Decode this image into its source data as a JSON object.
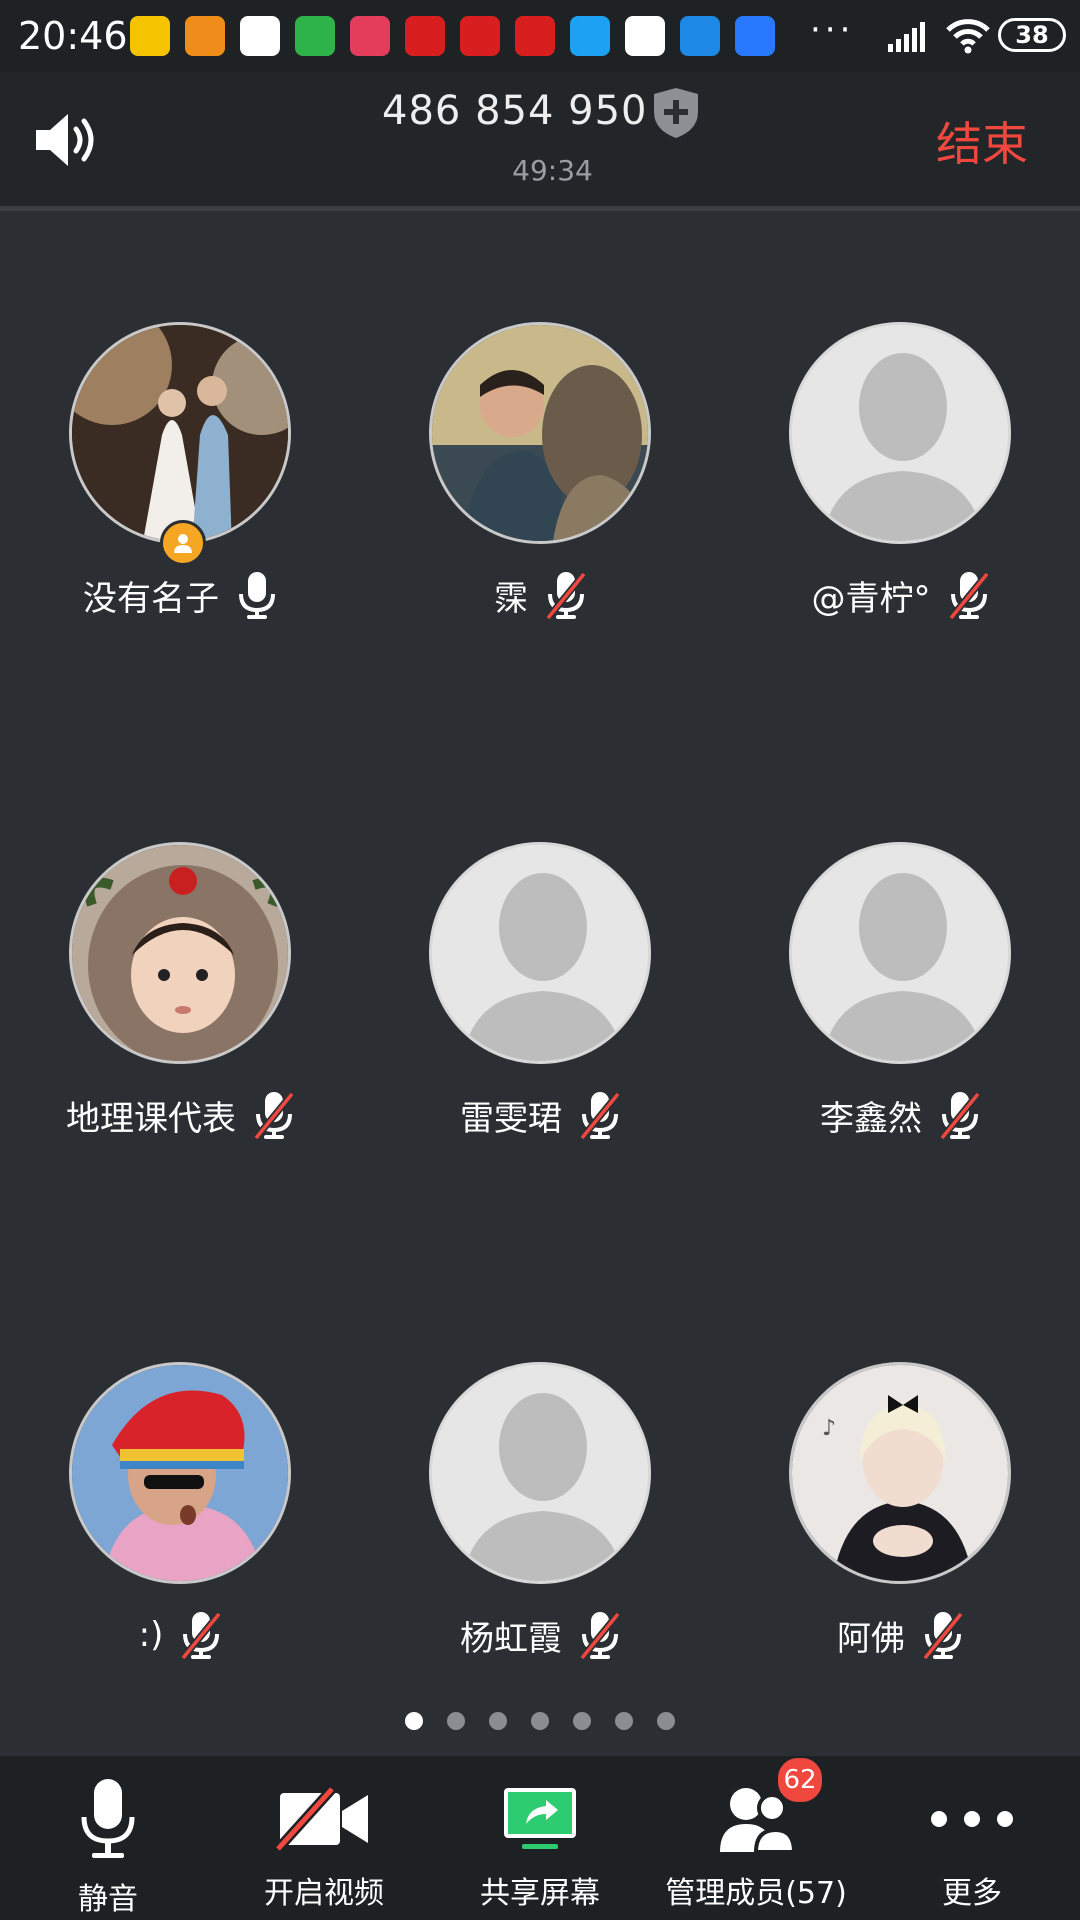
{
  "status_bar": {
    "time": "20:46",
    "battery": "38",
    "app_icons": [
      {
        "name": "app-icon-1",
        "color": "#f5c400"
      },
      {
        "name": "app-icon-fang",
        "color": "#f08c1a"
      },
      {
        "name": "app-icon-mi",
        "color": "#ffffff"
      },
      {
        "name": "app-icon-play",
        "color": "#2db34a"
      },
      {
        "name": "app-icon-cartoon",
        "color": "#e43d5b"
      },
      {
        "name": "app-icon-red-1",
        "color": "#d81e1e"
      },
      {
        "name": "app-icon-red-2",
        "color": "#d81e1e"
      },
      {
        "name": "app-icon-red-3",
        "color": "#d81e1e"
      },
      {
        "name": "app-icon-blue",
        "color": "#1da1f2"
      },
      {
        "name": "app-icon-youku",
        "color": "#ffffff"
      },
      {
        "name": "app-icon-n",
        "color": "#1e88e5"
      },
      {
        "name": "app-icon-map",
        "color": "#2979ff"
      }
    ],
    "overflow": "···"
  },
  "header": {
    "meeting_id": "486 854 950",
    "duration": "49:34",
    "end_label": "结束"
  },
  "participants": [
    {
      "name": "没有名子",
      "muted": false,
      "avatar": "photo-wedding",
      "host": true
    },
    {
      "name": "霂",
      "muted": true,
      "avatar": "photo-boys"
    },
    {
      "name": "@青柠°",
      "muted": true,
      "avatar": "default"
    },
    {
      "name": "地理课代表",
      "muted": true,
      "avatar": "photo-child"
    },
    {
      "name": "雷雯珺",
      "muted": true,
      "avatar": "default"
    },
    {
      "name": "李鑫然",
      "muted": true,
      "avatar": "default"
    },
    {
      "name": ":)",
      "muted": true,
      "avatar": "photo-hat"
    },
    {
      "name": "杨虹霞",
      "muted": true,
      "avatar": "default"
    },
    {
      "name": "阿佛",
      "muted": true,
      "avatar": "photo-idol"
    }
  ],
  "pagination": {
    "pages": 7,
    "current": 1
  },
  "toolbar": {
    "mute_label": "静音",
    "video_label": "开启视频",
    "share_label": "共享屏幕",
    "members_label": "管理成员(57)",
    "members_badge": "62",
    "more_label": "更多"
  },
  "colors": {
    "background": "#2b2e33",
    "end": "#f0483e",
    "share_green": "#2ecc71",
    "host_badge": "#f5a623"
  }
}
